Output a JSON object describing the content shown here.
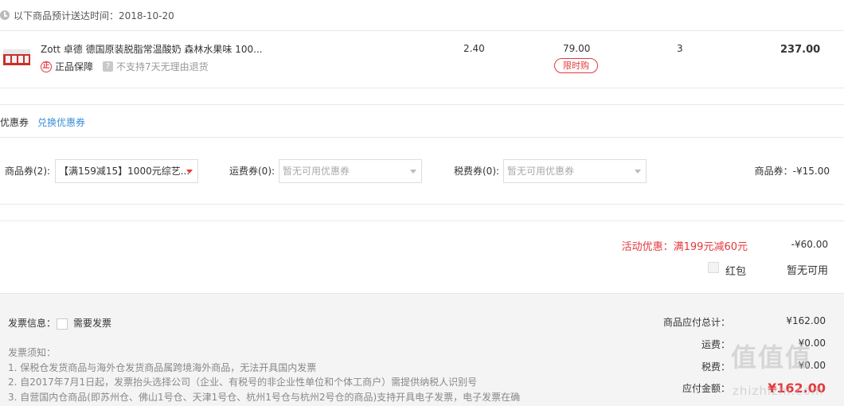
{
  "delivery": {
    "text": "以下商品预计送达时间：2018-10-20"
  },
  "product": {
    "name": "Zott 卓德 德国原装脱脂常温酸奶 森林水果味 100...",
    "badge_genuine": "正品保障",
    "badge_genuine_icon": "正",
    "badge_return_icon": "?",
    "badge_return": "不支持7天无理由退货",
    "tax": "2.40",
    "price": "79.00",
    "tag": "限时购",
    "qty": "3",
    "total": "237.00"
  },
  "coupon": {
    "title": "优惠券",
    "redeem_link": "兑换优惠券",
    "goods_label": "商品券(2):",
    "goods_selected": "【满159减15】1000元综艺...",
    "shipping_label": "运费券(0):",
    "shipping_placeholder": "暂无可用优惠券",
    "tax_label": "税费券(0):",
    "tax_placeholder": "暂无可用优惠券",
    "discount": "商品券：-¥15.00"
  },
  "promotion": {
    "label": "活动优惠：满199元减60元",
    "value": "-¥60.00",
    "hongbao_label": "红包",
    "hongbao_value": "暂无可用"
  },
  "invoice": {
    "label": "发票信息：",
    "need_label": "需要发票",
    "notes": [
      "发票须知：",
      "1. 保税仓发货商品与海外仓发货商品属跨境海外商品，无法开具国内发票",
      "2. 自2017年7月1日起，发票抬头选择公司（企业、有税号的非企业性单位和个体工商户）需提供纳税人识别号",
      "3. 自营国内仓商品(即苏州仓、佛山1号仓、天津1号仓、杭州1号仓与杭州2号仓的商品)支持开具电子发票，电子发票在确"
    ]
  },
  "summary": {
    "subtotal_label": "商品应付总计：",
    "subtotal_value": "¥162.00",
    "shipping_label": "运费：",
    "shipping_value": "¥0.00",
    "tax_label": "税费：",
    "tax_value": "¥0.00",
    "payable_label": "应付金额：",
    "payable_value": "¥162.00"
  },
  "watermark": {
    "main": "值值值",
    "sub": "zhizhizhi.com"
  },
  "colors": {
    "accent": "#e4393c",
    "link": "#3a8fd8",
    "footer_bg": "#f4f4f4"
  }
}
